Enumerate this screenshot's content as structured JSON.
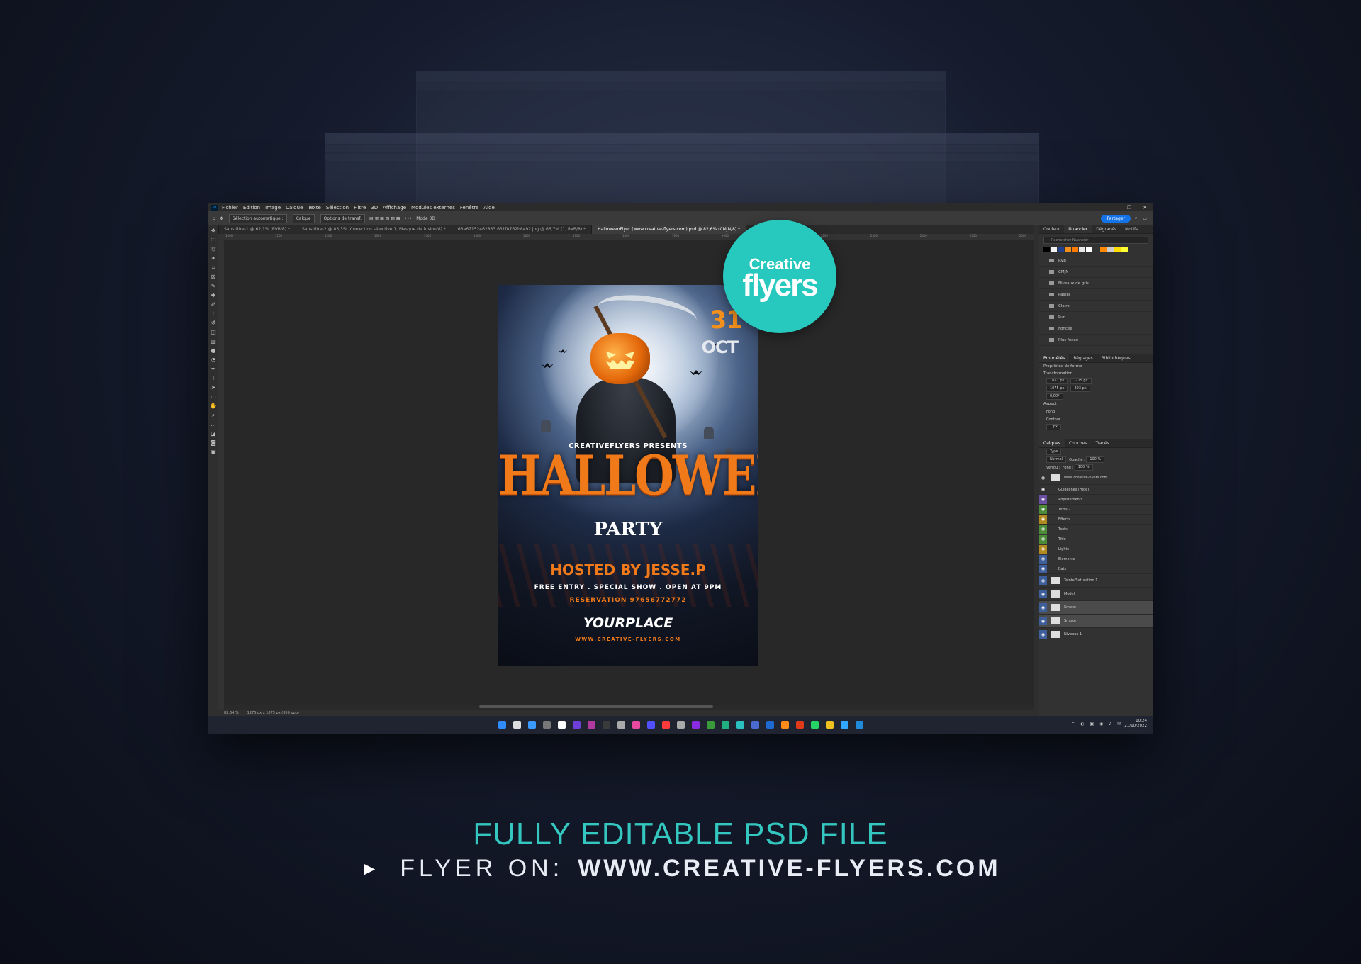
{
  "app": {
    "menu": [
      "Fichier",
      "Edition",
      "Image",
      "Calque",
      "Texte",
      "Sélection",
      "Filtre",
      "3D",
      "Affichage",
      "Modules externes",
      "Fenêtre",
      "Aide"
    ],
    "window_controls": [
      "—",
      "❐",
      "✕"
    ]
  },
  "options_bar": {
    "auto_select": "Sélection automatique :",
    "layer_dropdown": "Calque",
    "transform_options": "Options de transf.",
    "mode_3d": "Mode 3D :",
    "share_label": "Partager"
  },
  "tabs": [
    {
      "label": "Sans titre-1 @ 62,1% (RVB/8) *",
      "active": false
    },
    {
      "label": "Sans titre-2 @ 83,3% (Correction sélective 1, Masque de fusion/8) *",
      "active": false
    },
    {
      "label": "63a67152462833.631f0762b8492.jpg @ 66,7% (1, RVB/8) *",
      "active": false
    },
    {
      "label": "HalloweenFlyer (www.creative-flyers.com).psd @ 82,6% (CMJN/8) *",
      "active": true
    }
  ],
  "ruler_ticks": [
    "1000",
    "1100",
    "1200",
    "1300",
    "1400",
    "1500",
    "1600",
    "1700",
    "1800",
    "1900",
    "2000",
    "2100",
    "2200",
    "2300",
    "2400",
    "2500",
    "2600"
  ],
  "status": {
    "zoom": "82,64 %",
    "doc_size": "1275 px x 1875 px (300 ppp)"
  },
  "swatches_panel": {
    "tabs": [
      {
        "label": "Couleur",
        "on": false
      },
      {
        "label": "Nuancier",
        "on": true
      },
      {
        "label": "Dégradés",
        "on": false
      },
      {
        "label": "Motifs",
        "on": false
      }
    ],
    "search_placeholder": "Rechercher Nuancier",
    "colors": [
      "#000000",
      "#f3f3f3",
      "#1f3f8f",
      "#f4901c",
      "#ff7a00",
      "#e9e9e9",
      "#ffffff",
      "#333333",
      "#ff8800",
      "#cccccc",
      "#ffdd00",
      "#ffff33"
    ],
    "folders": [
      "RVB",
      "CMJN",
      "Niveaux de gris",
      "Pastel",
      "Claire",
      "Pur",
      "Foncée",
      "Plus foncé"
    ]
  },
  "properties_panel": {
    "tabs": [
      {
        "label": "Propriétés",
        "on": true
      },
      {
        "label": "Réglages",
        "on": false
      },
      {
        "label": "Bibliothèques",
        "on": false
      }
    ],
    "kind": "Propriétés de forme",
    "transform_title": "Transformation",
    "w": "1851 px",
    "x": "-215 px",
    "h": "1075 px",
    "y": "893 px",
    "angle": "0,00°",
    "aspect_title": "Aspect",
    "fill_label": "Fond",
    "stroke_label": "Contour",
    "stroke_width": "1 px"
  },
  "layers_panel": {
    "tabs": [
      {
        "label": "Calques",
        "on": true
      },
      {
        "label": "Couches",
        "on": false
      },
      {
        "label": "Tracés",
        "on": false
      }
    ],
    "filter_type": "Type",
    "blend_mode": "Normal",
    "opacity_label": "Opacité :",
    "opacity": "100 %",
    "lock_label": "Verrou :",
    "fill_label": "Fond :",
    "fill": "100 %",
    "layers": [
      {
        "name": "www.creative-flyers.com",
        "color": "#323232",
        "thumb": true
      },
      {
        "name": "Guidelines (Hide)",
        "color": "#323232",
        "thumb": false
      },
      {
        "name": "Adjustements",
        "color": "#6a4fa3",
        "thumb": false
      },
      {
        "name": "Texts 2",
        "color": "#4d8a3a",
        "thumb": false
      },
      {
        "name": "Effects",
        "color": "#b08a1e",
        "thumb": false
      },
      {
        "name": "Texts",
        "color": "#4d8a3a",
        "thumb": false
      },
      {
        "name": "Title",
        "color": "#4d8a3a",
        "thumb": false
      },
      {
        "name": "Lights",
        "color": "#b08a1e",
        "thumb": false
      },
      {
        "name": "Elements",
        "color": "#3f5f9a",
        "thumb": false
      },
      {
        "name": "Bats",
        "color": "#3f5f9a",
        "thumb": false
      },
      {
        "name": "Teinte/Saturation 1",
        "color": "#3f5f9a",
        "thumb": true
      },
      {
        "name": "Model",
        "color": "#3f5f9a",
        "thumb": true
      },
      {
        "name": "Smoke",
        "color": "#3f5f9a",
        "thumb": true
      },
      {
        "name": "Smoke",
        "color": "#3f5f9a",
        "thumb": true
      },
      {
        "name": "Niveaux 1",
        "color": "#3f5f9a",
        "thumb": true
      }
    ]
  },
  "taskbar": {
    "icon_colors": [
      "#2f8cff",
      "#dddddd",
      "#3a9aff",
      "#777777",
      "#ffffff",
      "#6e3fd8",
      "#b03aa0",
      "#3a3a3a",
      "#aaaaaa",
      "#e84aa0",
      "#5050ff",
      "#ff3a3a",
      "#aaaaaa",
      "#8a2be2",
      "#3a9a3a",
      "#20b080",
      "#2ac0c0",
      "#4a6ad0",
      "#1e6ad0",
      "#ff8c1a",
      "#e03a1a",
      "#25d366",
      "#f0c020",
      "#31a8ff",
      "#1f8ad8"
    ],
    "time": "10:24",
    "date": "21/10/2022"
  },
  "flyer": {
    "date_day": "31",
    "date_month": "OCT",
    "presents": "CREATIVEFLYERS PRESENTS",
    "title": "HALLOWEEN",
    "subtitle": "PARTY",
    "hosted": "HOSTED BY JESSE.P",
    "entry": "FREE ENTRY . SPECIAL SHOW . OPEN AT 9PM",
    "reservation": "RESERVATION 97656772772",
    "place": "YOURPLACE",
    "site": "WWW.CREATIVE-FLYERS.COM"
  },
  "badge": {
    "line1": "Creative",
    "line2": "flyers"
  },
  "caption": {
    "line1": "FULLY EDITABLE PSD FILE",
    "prefix": "FLYER ON:",
    "url": "WWW.CREATIVE-FLYERS.COM"
  },
  "colors": {
    "accent": "#34c7c0",
    "orange": "#f07a1a",
    "share_blue": "#1473e6"
  }
}
